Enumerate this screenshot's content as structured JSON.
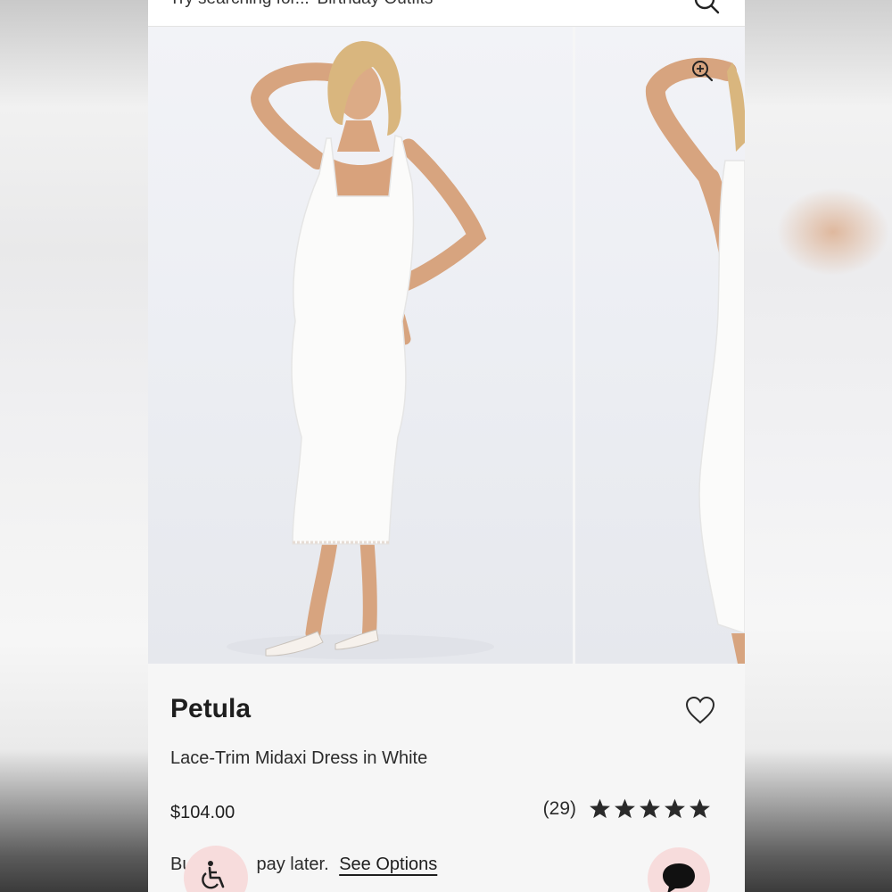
{
  "search": {
    "placeholder_text": "Try searching for... 'Birthday Outfits'"
  },
  "icons": {
    "search": "search-icon",
    "zoom": "zoom-in-icon",
    "wishlist": "heart-outline-icon",
    "star": "star-filled-icon",
    "accessibility": "wheelchair-icon",
    "chat": "chat-bubble-icon"
  },
  "product": {
    "name": "Petula",
    "description": "Lace-Trim Midaxi Dress in White",
    "price": "$104.00",
    "review_count": "(29)",
    "rating": 5,
    "rating_max": 5
  },
  "payment": {
    "text_start": "Bu",
    "text_end": "pay later.",
    "link_label": "See Options"
  },
  "colors": {
    "accent_bubble": "#f7dcdc",
    "text": "#1e1e1e",
    "background": "#f6f6f6"
  }
}
